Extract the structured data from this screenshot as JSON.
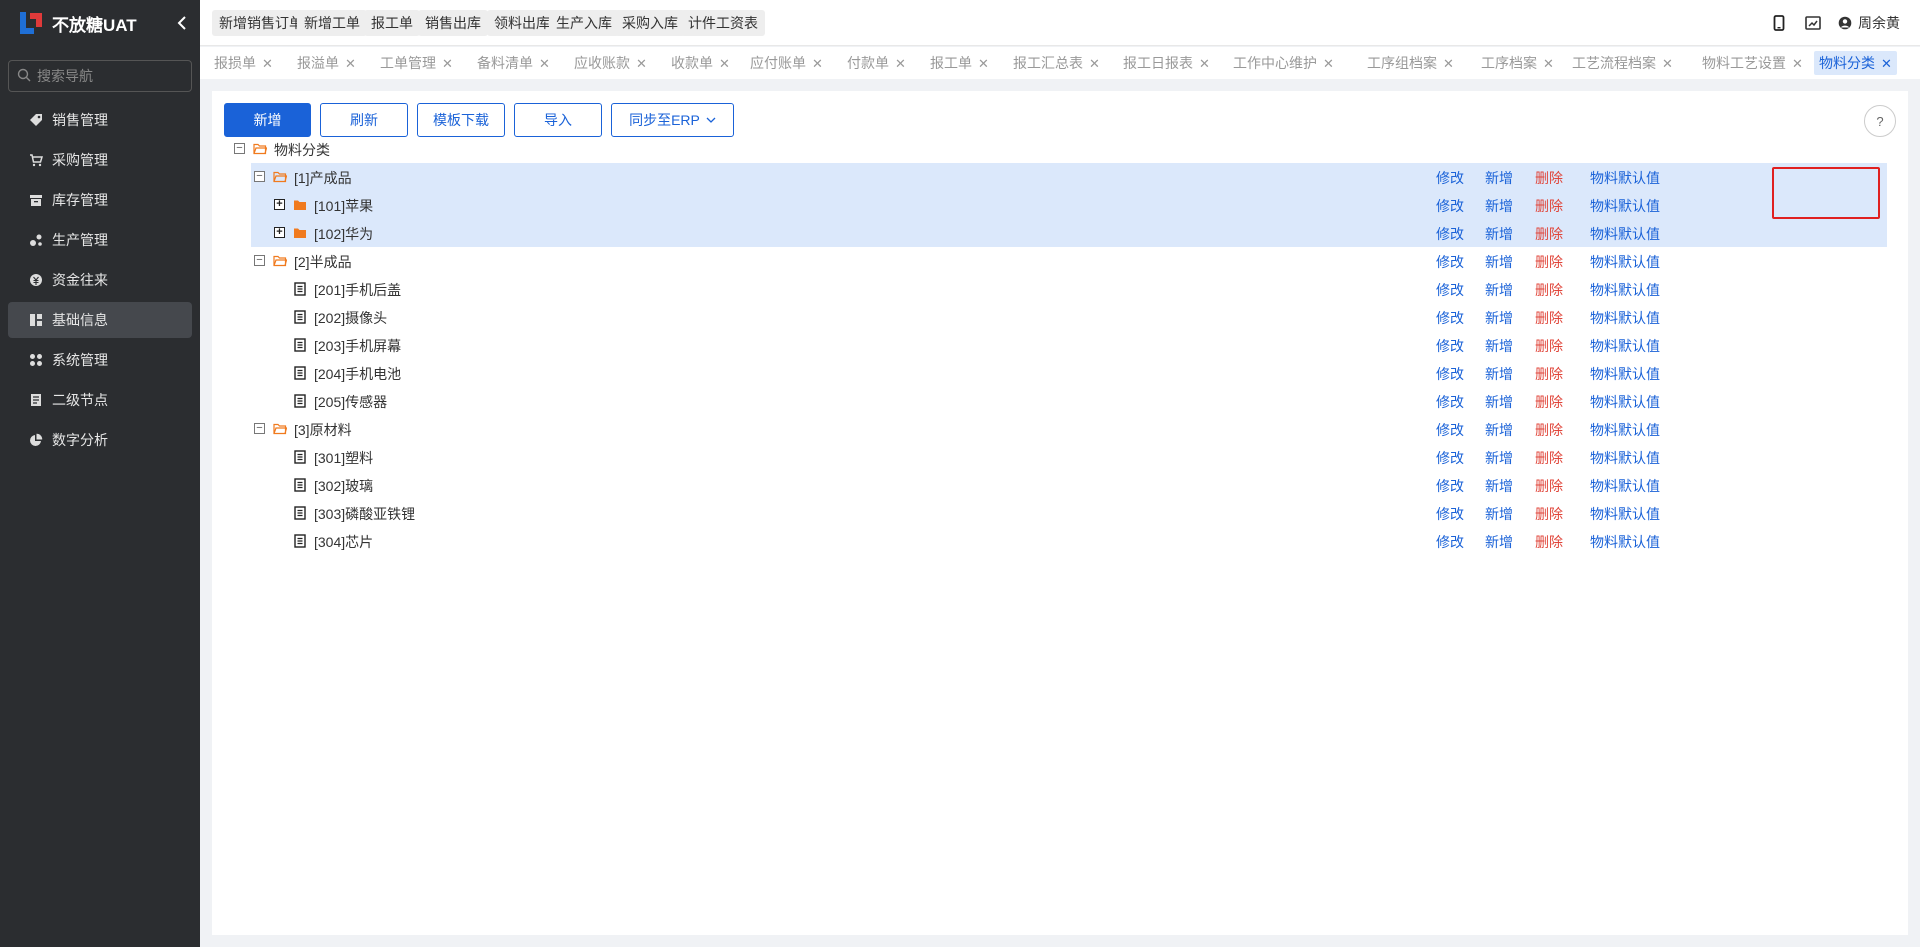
{
  "app": {
    "title": "不放糖UAT",
    "collapse_icon": "chevron-left-icon"
  },
  "search": {
    "placeholder": "搜索导航"
  },
  "sidebar": {
    "items": [
      {
        "label": "销售管理",
        "icon": "tag-icon",
        "active": false
      },
      {
        "label": "采购管理",
        "icon": "cart-icon",
        "active": false
      },
      {
        "label": "库存管理",
        "icon": "archive-icon",
        "active": false
      },
      {
        "label": "生产管理",
        "icon": "production-icon",
        "active": false
      },
      {
        "label": "资金往来",
        "icon": "money-icon",
        "active": false
      },
      {
        "label": "基础信息",
        "icon": "basic-info-icon",
        "active": true
      },
      {
        "label": "系统管理",
        "icon": "apps-icon",
        "active": false
      },
      {
        "label": "二级节点",
        "icon": "document-icon",
        "active": false
      },
      {
        "label": "数字分析",
        "icon": "pie-chart-icon",
        "active": false
      }
    ]
  },
  "quick_actions": [
    "新增销售订单",
    "新增工单",
    "报工单",
    "销售出库",
    "领料出库",
    "生产入库",
    "采购入库",
    "计件工资表"
  ],
  "header": {
    "user_name": "周余黄"
  },
  "tabs": [
    {
      "label": "报损单",
      "active": false
    },
    {
      "label": "报溢单",
      "active": false
    },
    {
      "label": "工单管理",
      "active": false
    },
    {
      "label": "备料清单",
      "active": false
    },
    {
      "label": "应收账款",
      "active": false
    },
    {
      "label": "收款单",
      "active": false
    },
    {
      "label": "应付账单",
      "active": false
    },
    {
      "label": "付款单",
      "active": false
    },
    {
      "label": "报工单",
      "active": false
    },
    {
      "label": "报工汇总表",
      "active": false
    },
    {
      "label": "报工日报表",
      "active": false
    },
    {
      "label": "工作中心维护",
      "active": false
    },
    {
      "label": "工序组档案",
      "active": false
    },
    {
      "label": "工序档案",
      "active": false
    },
    {
      "label": "工艺流程档案",
      "active": false
    },
    {
      "label": "物料工艺设置",
      "active": false
    },
    {
      "label": "物料分类",
      "active": true
    }
  ],
  "toolbar": {
    "add_label": "新增",
    "refresh_label": "刷新",
    "template_label": "模板下载",
    "import_label": "导入",
    "sync_label": "同步至ERP"
  },
  "row_actions": {
    "edit": "修改",
    "add": "新增",
    "delete": "删除",
    "defaults": "物料默认值"
  },
  "colors": {
    "accent": "#1a62d8",
    "danger": "#e0453a",
    "folder": "#f07a1e",
    "sidebar_bg": "#2b2d30",
    "highlight": "#dbe8fb"
  },
  "tree": [
    {
      "label": "物料分类",
      "level": 0,
      "type": "folder-open",
      "toggle": "minus",
      "actions": false,
      "highlight": false
    },
    {
      "label": "[1]产成品",
      "level": 1,
      "type": "folder-open",
      "toggle": "minus",
      "actions": true,
      "highlight": true
    },
    {
      "label": "[101]苹果",
      "level": 2,
      "type": "folder-closed",
      "toggle": "plus",
      "actions": true,
      "highlight": true
    },
    {
      "label": "[102]华为",
      "level": 2,
      "type": "folder-closed",
      "toggle": "plus",
      "actions": true,
      "highlight": true
    },
    {
      "label": "[2]半成品",
      "level": 1,
      "type": "folder-open",
      "toggle": "minus",
      "actions": true,
      "highlight": false
    },
    {
      "label": "[201]手机后盖",
      "level": 2,
      "type": "doc",
      "toggle": "none",
      "actions": true,
      "highlight": false
    },
    {
      "label": "[202]摄像头",
      "level": 2,
      "type": "doc",
      "toggle": "none",
      "actions": true,
      "highlight": false
    },
    {
      "label": "[203]手机屏幕",
      "level": 2,
      "type": "doc",
      "toggle": "none",
      "actions": true,
      "highlight": false
    },
    {
      "label": "[204]手机电池",
      "level": 2,
      "type": "doc",
      "toggle": "none",
      "actions": true,
      "highlight": false
    },
    {
      "label": "[205]传感器",
      "level": 2,
      "type": "doc",
      "toggle": "none",
      "actions": true,
      "highlight": false
    },
    {
      "label": "[3]原材料",
      "level": 1,
      "type": "folder-open",
      "toggle": "minus",
      "actions": true,
      "highlight": false
    },
    {
      "label": "[301]塑料",
      "level": 2,
      "type": "doc",
      "toggle": "none",
      "actions": true,
      "highlight": false
    },
    {
      "label": "[302]玻璃",
      "level": 2,
      "type": "doc",
      "toggle": "none",
      "actions": true,
      "highlight": false
    },
    {
      "label": "[303]磷酸亚铁锂",
      "level": 2,
      "type": "doc",
      "toggle": "none",
      "actions": true,
      "highlight": false
    },
    {
      "label": "[304]芯片",
      "level": 2,
      "type": "doc",
      "toggle": "none",
      "actions": true,
      "highlight": false
    }
  ]
}
